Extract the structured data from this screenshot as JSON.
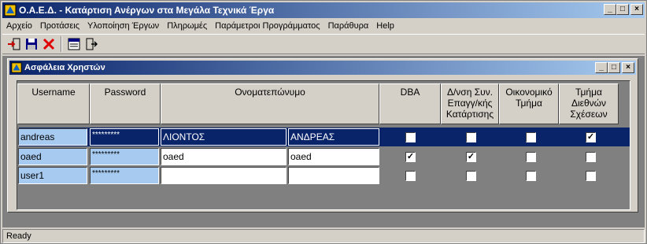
{
  "window": {
    "title": "Ο.Α.Ε.Δ. - Κατάρτιση Ανέργων στα Μεγάλα Τεχνικά Έργα"
  },
  "menu": [
    "Αρχείο",
    "Προτάσεις",
    "Υλοποίηση Έργων",
    "Πληρωμές",
    "Παράμετροι Προγράμματος",
    "Παράθυρα",
    "Help"
  ],
  "toolbar": {
    "icons": [
      "login-icon",
      "save-icon",
      "delete-icon",
      "window-icon",
      "exit-icon"
    ]
  },
  "child": {
    "title": "Ασφάλεια Χρηστών"
  },
  "columns": [
    "Username",
    "Password",
    "Ονοματεπώνυμο",
    "DBA",
    "Δ/νση Συν. Επαγγ/κής Κατάρτισης",
    "Οικονομικό Τμήμα",
    "Τμήμα Διεθνών Σχέσεων"
  ],
  "rows": [
    {
      "username": "andreas",
      "password": "*********",
      "surname": "ΛΙΟΝΤΟΣ",
      "firstname": "ΑΝΔΡΕΑΣ",
      "dba": false,
      "training": false,
      "finance": false,
      "intl": true
    },
    {
      "username": "oaed",
      "password": "*********",
      "surname": "oaed",
      "firstname": "oaed",
      "dba": true,
      "training": true,
      "finance": false,
      "intl": false
    },
    {
      "username": "user1",
      "password": "*********",
      "surname": "",
      "firstname": "",
      "dba": false,
      "training": false,
      "finance": false,
      "intl": false
    }
  ],
  "status": "Ready",
  "colors": {
    "title_bar": "#0a246a",
    "selected_row": "#0a246a",
    "key_cell": "#a6caf0"
  }
}
